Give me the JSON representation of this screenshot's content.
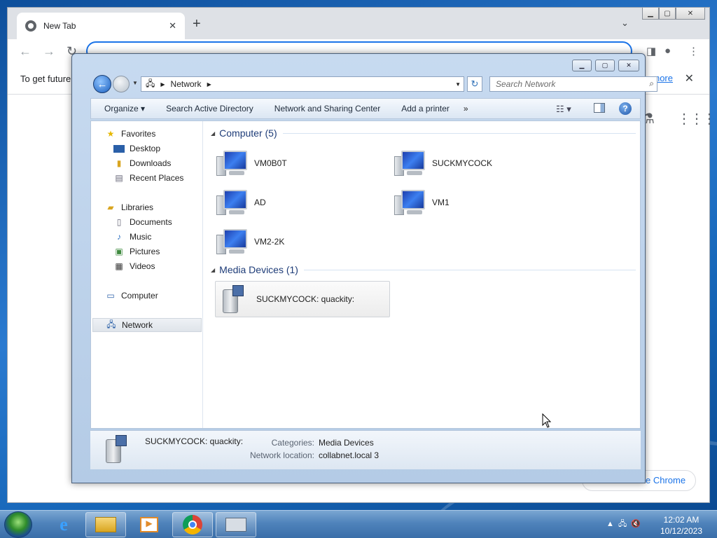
{
  "chrome": {
    "tab_title": "New Tab",
    "tab_close": "✕",
    "new_tab": "+",
    "infobar_text": "To get future",
    "learn_more": "n more",
    "customize": "e Chrome"
  },
  "explorer": {
    "address": "Network",
    "search_placeholder": "Search Network",
    "toolbar": {
      "organize": "Organize ▾",
      "search_ad": "Search Active Directory",
      "sharing": "Network and Sharing Center",
      "printer": "Add a printer",
      "more": "»"
    },
    "nav": {
      "favorites": "Favorites",
      "desktop": "Desktop",
      "downloads": "Downloads",
      "recent": "Recent Places",
      "libraries": "Libraries",
      "documents": "Documents",
      "music": "Music",
      "pictures": "Pictures",
      "videos": "Videos",
      "computer": "Computer",
      "network": "Network"
    },
    "groups": {
      "computer": "Computer (5)",
      "media": "Media Devices (1)"
    },
    "computers": [
      "VM0B0T",
      "SUCKMYCOCK",
      "AD",
      "VM1",
      "VM2-2K"
    ],
    "media_device": "SUCKMYCOCK: quackity:",
    "details": {
      "name": "SUCKMYCOCK: quackity:",
      "categories_label": "Categories:",
      "categories_value": "Media Devices",
      "location_label": "Network location:",
      "location_value": "collabnet.local  3"
    }
  },
  "taskbar": {
    "time": "12:02 AM",
    "date": "10/12/2023"
  }
}
